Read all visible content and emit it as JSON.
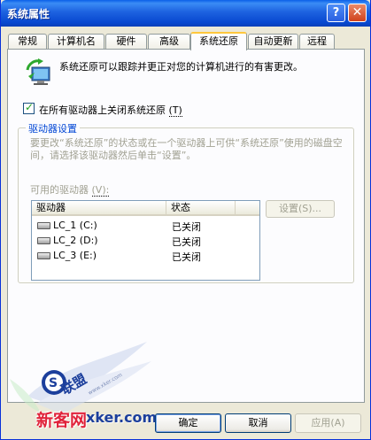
{
  "window": {
    "title": "系统属性",
    "help_label": "?",
    "close_label": "✕"
  },
  "tabs": [
    {
      "label": "常规",
      "accel": ""
    },
    {
      "label": "计算机名",
      "accel": ""
    },
    {
      "label": "硬件",
      "accel": ""
    },
    {
      "label": "高级",
      "accel": ""
    },
    {
      "label": "系统还原",
      "accel": ""
    },
    {
      "label": "自动更新",
      "accel": ""
    },
    {
      "label": "远程",
      "accel": ""
    }
  ],
  "active_tab": "系统还原",
  "intro": {
    "icon": "system-restore-icon",
    "text": "系统还原可以跟踪并更正对您的计算机进行的有害更改。"
  },
  "disable_all": {
    "checked": true,
    "label": "在所有驱动器上关闭系统还原",
    "accel": "(T)"
  },
  "drive_settings": {
    "title": "驱动器设置",
    "description": "要更改“系统还原”的状态或在一个驱动器上可供“系统还原”使用的磁盘空间，请选择该驱动器然后单击“设置”。",
    "available_label": "可用的驱动器",
    "available_accel": "(V):",
    "columns": [
      "驱动器",
      "状态"
    ],
    "drives": [
      {
        "name": "LC_1 (C:)",
        "status": "已关闭",
        "icon": "hard-drive-icon"
      },
      {
        "name": "LC_2 (D:)",
        "status": "已关闭",
        "icon": "hard-drive-icon"
      },
      {
        "name": "LC_3 (E:)",
        "status": "已关闭",
        "icon": "hard-drive-icon"
      }
    ],
    "settings_button": "设置(S)..."
  },
  "buttons": {
    "ok": "确定",
    "cancel": "取消",
    "apply": "应用(A)"
  },
  "watermark": {
    "brand": "新客网",
    "url": "xker.com"
  },
  "colors": {
    "title_blue": "#0a5fe8",
    "group_title": "#0046d5",
    "disabled_text": "#a1a192",
    "watermark_red": "#e0233a"
  }
}
